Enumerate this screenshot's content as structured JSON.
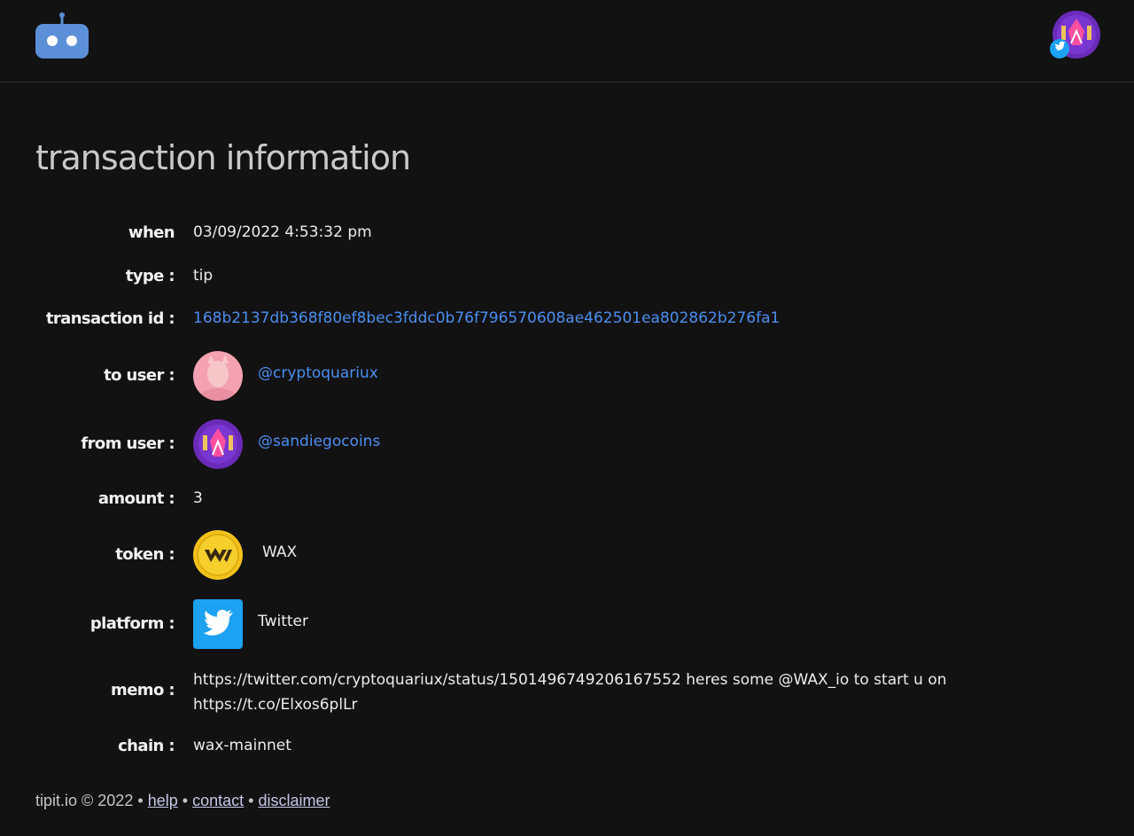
{
  "page_title": "transaction information",
  "fields": {
    "when": {
      "label": "when",
      "value": "03/09/2022 4:53:32 pm"
    },
    "type": {
      "label": "type :",
      "value": "tip"
    },
    "transaction_id": {
      "label": "transaction id :",
      "value": "168b2137db368f80ef8bec3fddc0b76f796570608ae462501ea802862b276fa1"
    },
    "to_user": {
      "label": "to user :",
      "value": "@cryptoquariux"
    },
    "from_user": {
      "label": "from user :",
      "value": "@sandiegocoins"
    },
    "amount": {
      "label": "amount :",
      "value": "3"
    },
    "token": {
      "label": "token :",
      "value": "WAX"
    },
    "platform": {
      "label": "platform :",
      "value": "Twitter"
    },
    "memo": {
      "label": "memo :",
      "value": "https://twitter.com/cryptoquariux/status/1501496749206167552 heres some @WAX_io to start u on https://t.co/Elxos6plLr"
    },
    "chain": {
      "label": "chain :",
      "value": "wax-mainnet"
    }
  },
  "footer": {
    "brand": "tipit.io © 2022",
    "sep": "•",
    "links": {
      "help": "help",
      "contact": "contact",
      "disclaimer": "disclaimer"
    }
  },
  "colors": {
    "background": "#121212",
    "link": "#4b8ef0",
    "logo": "#5b8fd8",
    "twitter": "#1da1f2",
    "wax": "#f3c21a"
  },
  "icons": {
    "logo": "robot-icon",
    "account": "user-avatar-icon",
    "platform": "twitter-bird-icon",
    "token": "wax-token-icon"
  }
}
